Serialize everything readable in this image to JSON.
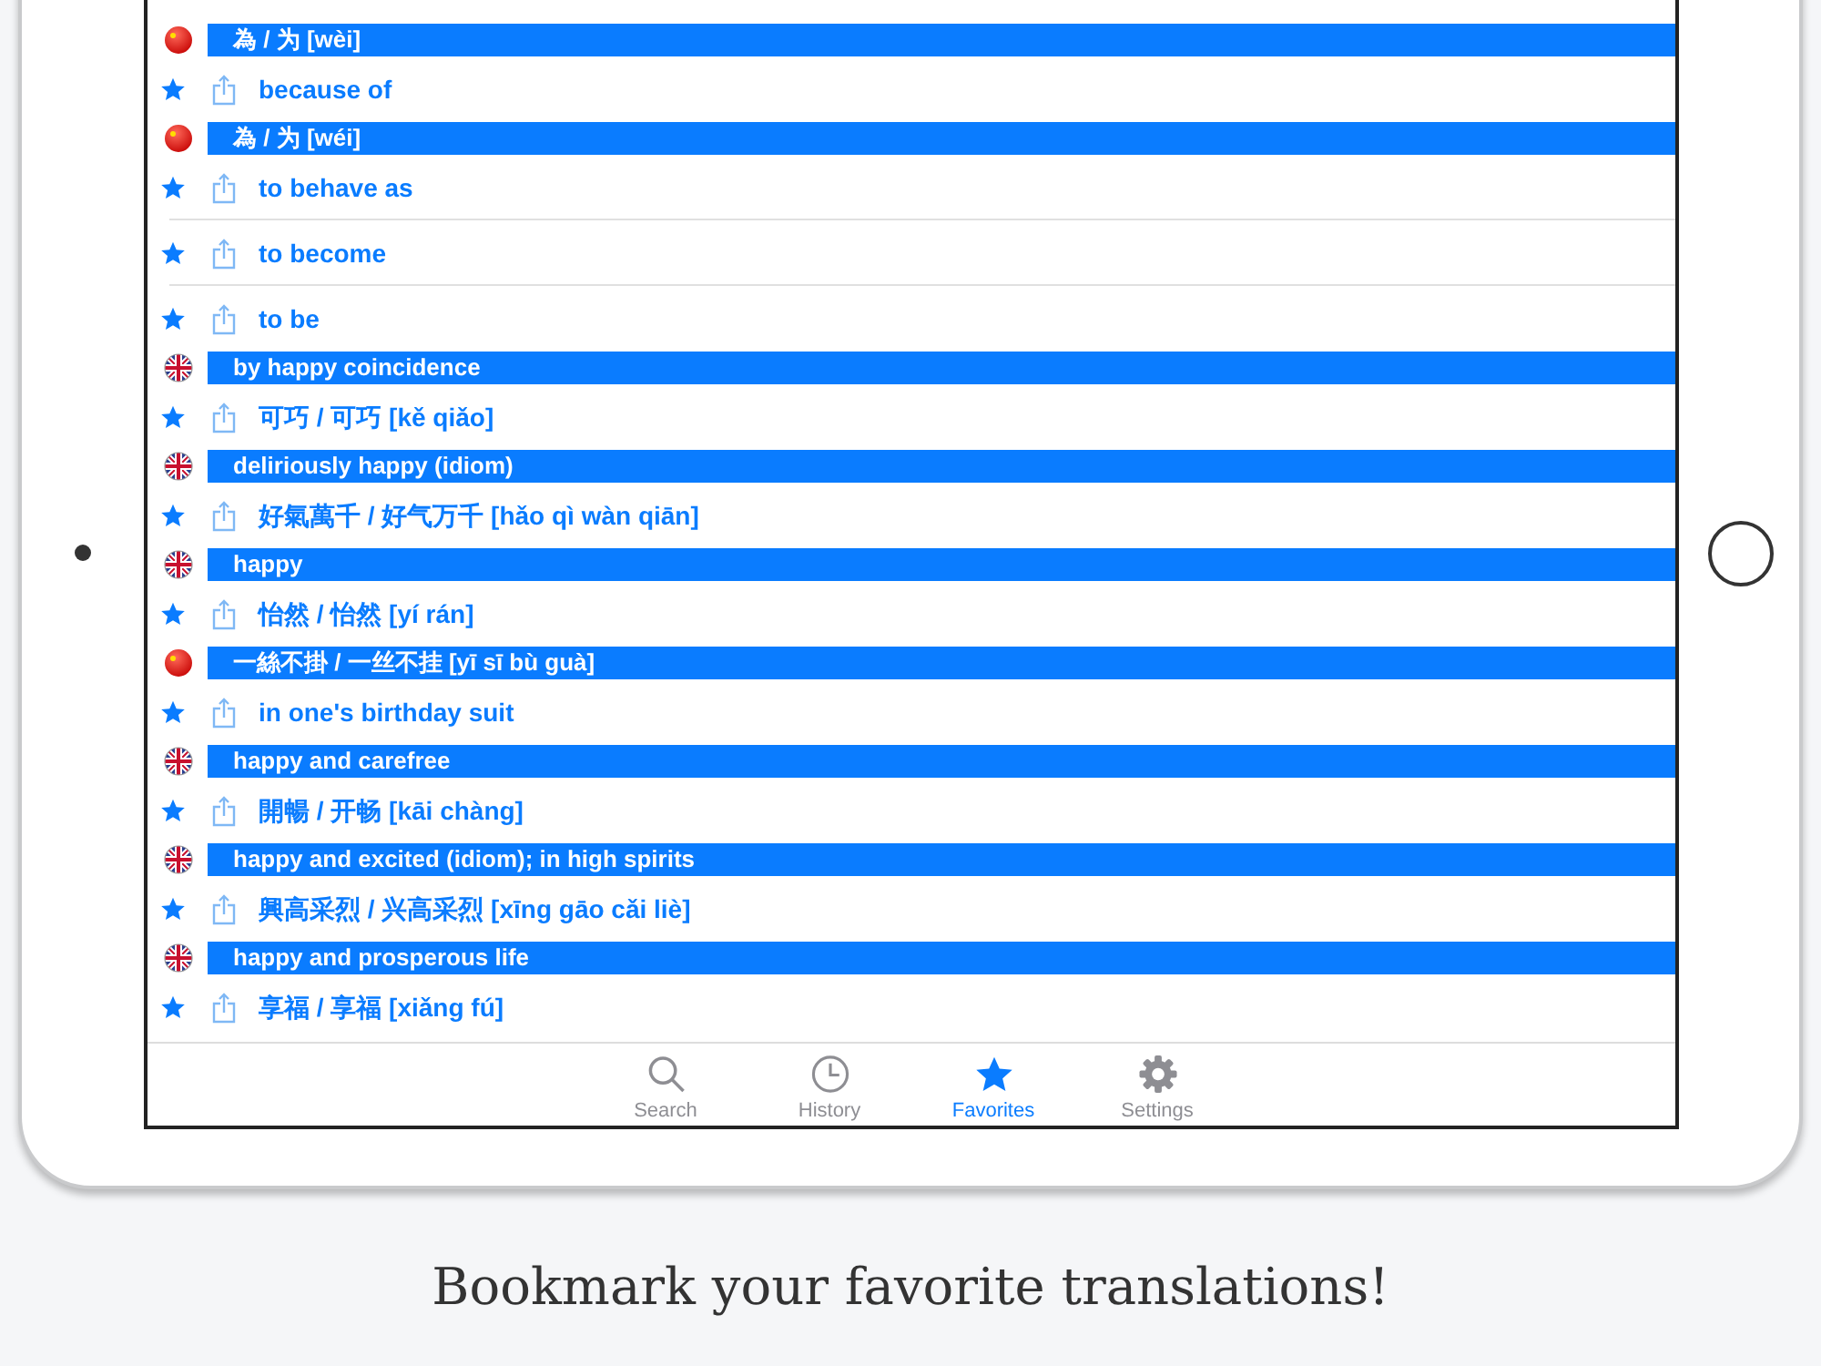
{
  "sections": [
    {
      "kind": "cn",
      "header": "為 / 为 [wèi]",
      "entries": [
        "because of"
      ]
    },
    {
      "kind": "cn",
      "header": "為 / 为 [wéi]",
      "entries": [
        "to behave as",
        "to become",
        "to be"
      ]
    },
    {
      "kind": "uk",
      "header": "by happy coincidence",
      "entries": [
        "可巧 / 可巧 [kě qiǎo]"
      ]
    },
    {
      "kind": "uk",
      "header": "deliriously happy (idiom)",
      "entries": [
        "好氣萬千 / 好气万千 [hǎo qì wàn qiān]"
      ]
    },
    {
      "kind": "uk",
      "header": "happy",
      "entries": [
        "怡然 / 怡然 [yí rán]"
      ]
    },
    {
      "kind": "cn",
      "header": "一絲不掛 / 一丝不挂 [yī sī bù guà]",
      "entries": [
        "in one's birthday suit"
      ]
    },
    {
      "kind": "uk",
      "header": "happy and carefree",
      "entries": [
        "開暢 / 开畅 [kāi chàng]"
      ]
    },
    {
      "kind": "uk",
      "header": "happy and excited (idiom); in high spirits",
      "entries": [
        "興高采烈 / 兴高采烈 [xīng gāo cǎi liè]"
      ]
    },
    {
      "kind": "uk",
      "header": "happy and prosperous life",
      "entries": [
        "享福 / 享福 [xiǎng fú]"
      ]
    }
  ],
  "tab_bar": [
    {
      "kind": "search",
      "label": "Search",
      "selected": false
    },
    {
      "kind": "history",
      "label": "History",
      "selected": false
    },
    {
      "kind": "favorites",
      "label": "Favorites",
      "selected": true
    },
    {
      "kind": "settings",
      "label": "Settings",
      "selected": false
    }
  ],
  "caption": "Bookmark your favorite translations!"
}
